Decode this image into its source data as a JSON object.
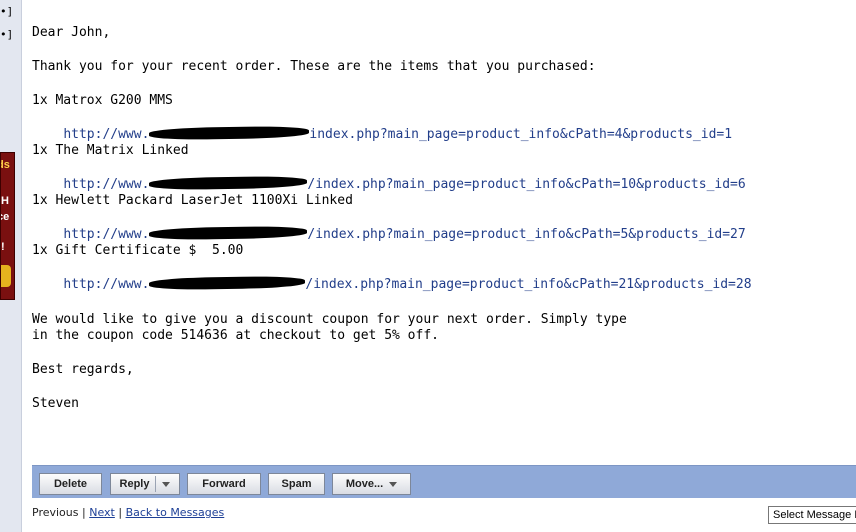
{
  "sidebar": {
    "control_top": "•]",
    "control_bottom": "•]",
    "ad_lines": [
      "ds",
      "H",
      "ce",
      "!"
    ]
  },
  "message": {
    "greeting": "Dear John,",
    "intro": "Thank you for your recent order. These are the items that you purchased:",
    "items": [
      {
        "name": "1x Matrox G200 MMS",
        "url_prefix": "http://www.",
        "url_suffix": "index.php?main_page=product_info&cPath=4&products_id=1"
      },
      {
        "name": "1x The Matrix Linked",
        "url_prefix": "http://www.",
        "url_suffix": "/index.php?main_page=product_info&cPath=10&products_id=6"
      },
      {
        "name": "1x Hewlett Packard LaserJet 1100Xi Linked",
        "url_prefix": "http://www.",
        "url_suffix": "/index.php?main_page=product_info&cPath=5&products_id=27"
      },
      {
        "name": "1x Gift Certificate $  5.00",
        "url_prefix": "http://www.",
        "url_suffix": "/index.php?main_page=product_info&cPath=21&products_id=28"
      }
    ],
    "coupon_line1": "We would like to give you a discount coupon for your next order. Simply type",
    "coupon_line2": "in the coupon code 514636 at checkout to get 5% off.",
    "closing": "Best regards,",
    "signature": "Steven"
  },
  "toolbar": {
    "delete_label": "Delete",
    "reply_label": "Reply",
    "forward_label": "Forward",
    "spam_label": "Spam",
    "move_label": "Move..."
  },
  "footer": {
    "previous_label": "Previous",
    "separator": "|",
    "next_label": "Next",
    "back_label": "Back to Messages",
    "select_label": "Select Message E"
  },
  "colors": {
    "toolbar_bg": "#8fa9d8",
    "link": "#223e8a",
    "sidebar_bg": "#e3e7f0"
  },
  "icons": {
    "redaction": "redaction-scribble",
    "dropdown": "chevron-down-icon"
  }
}
